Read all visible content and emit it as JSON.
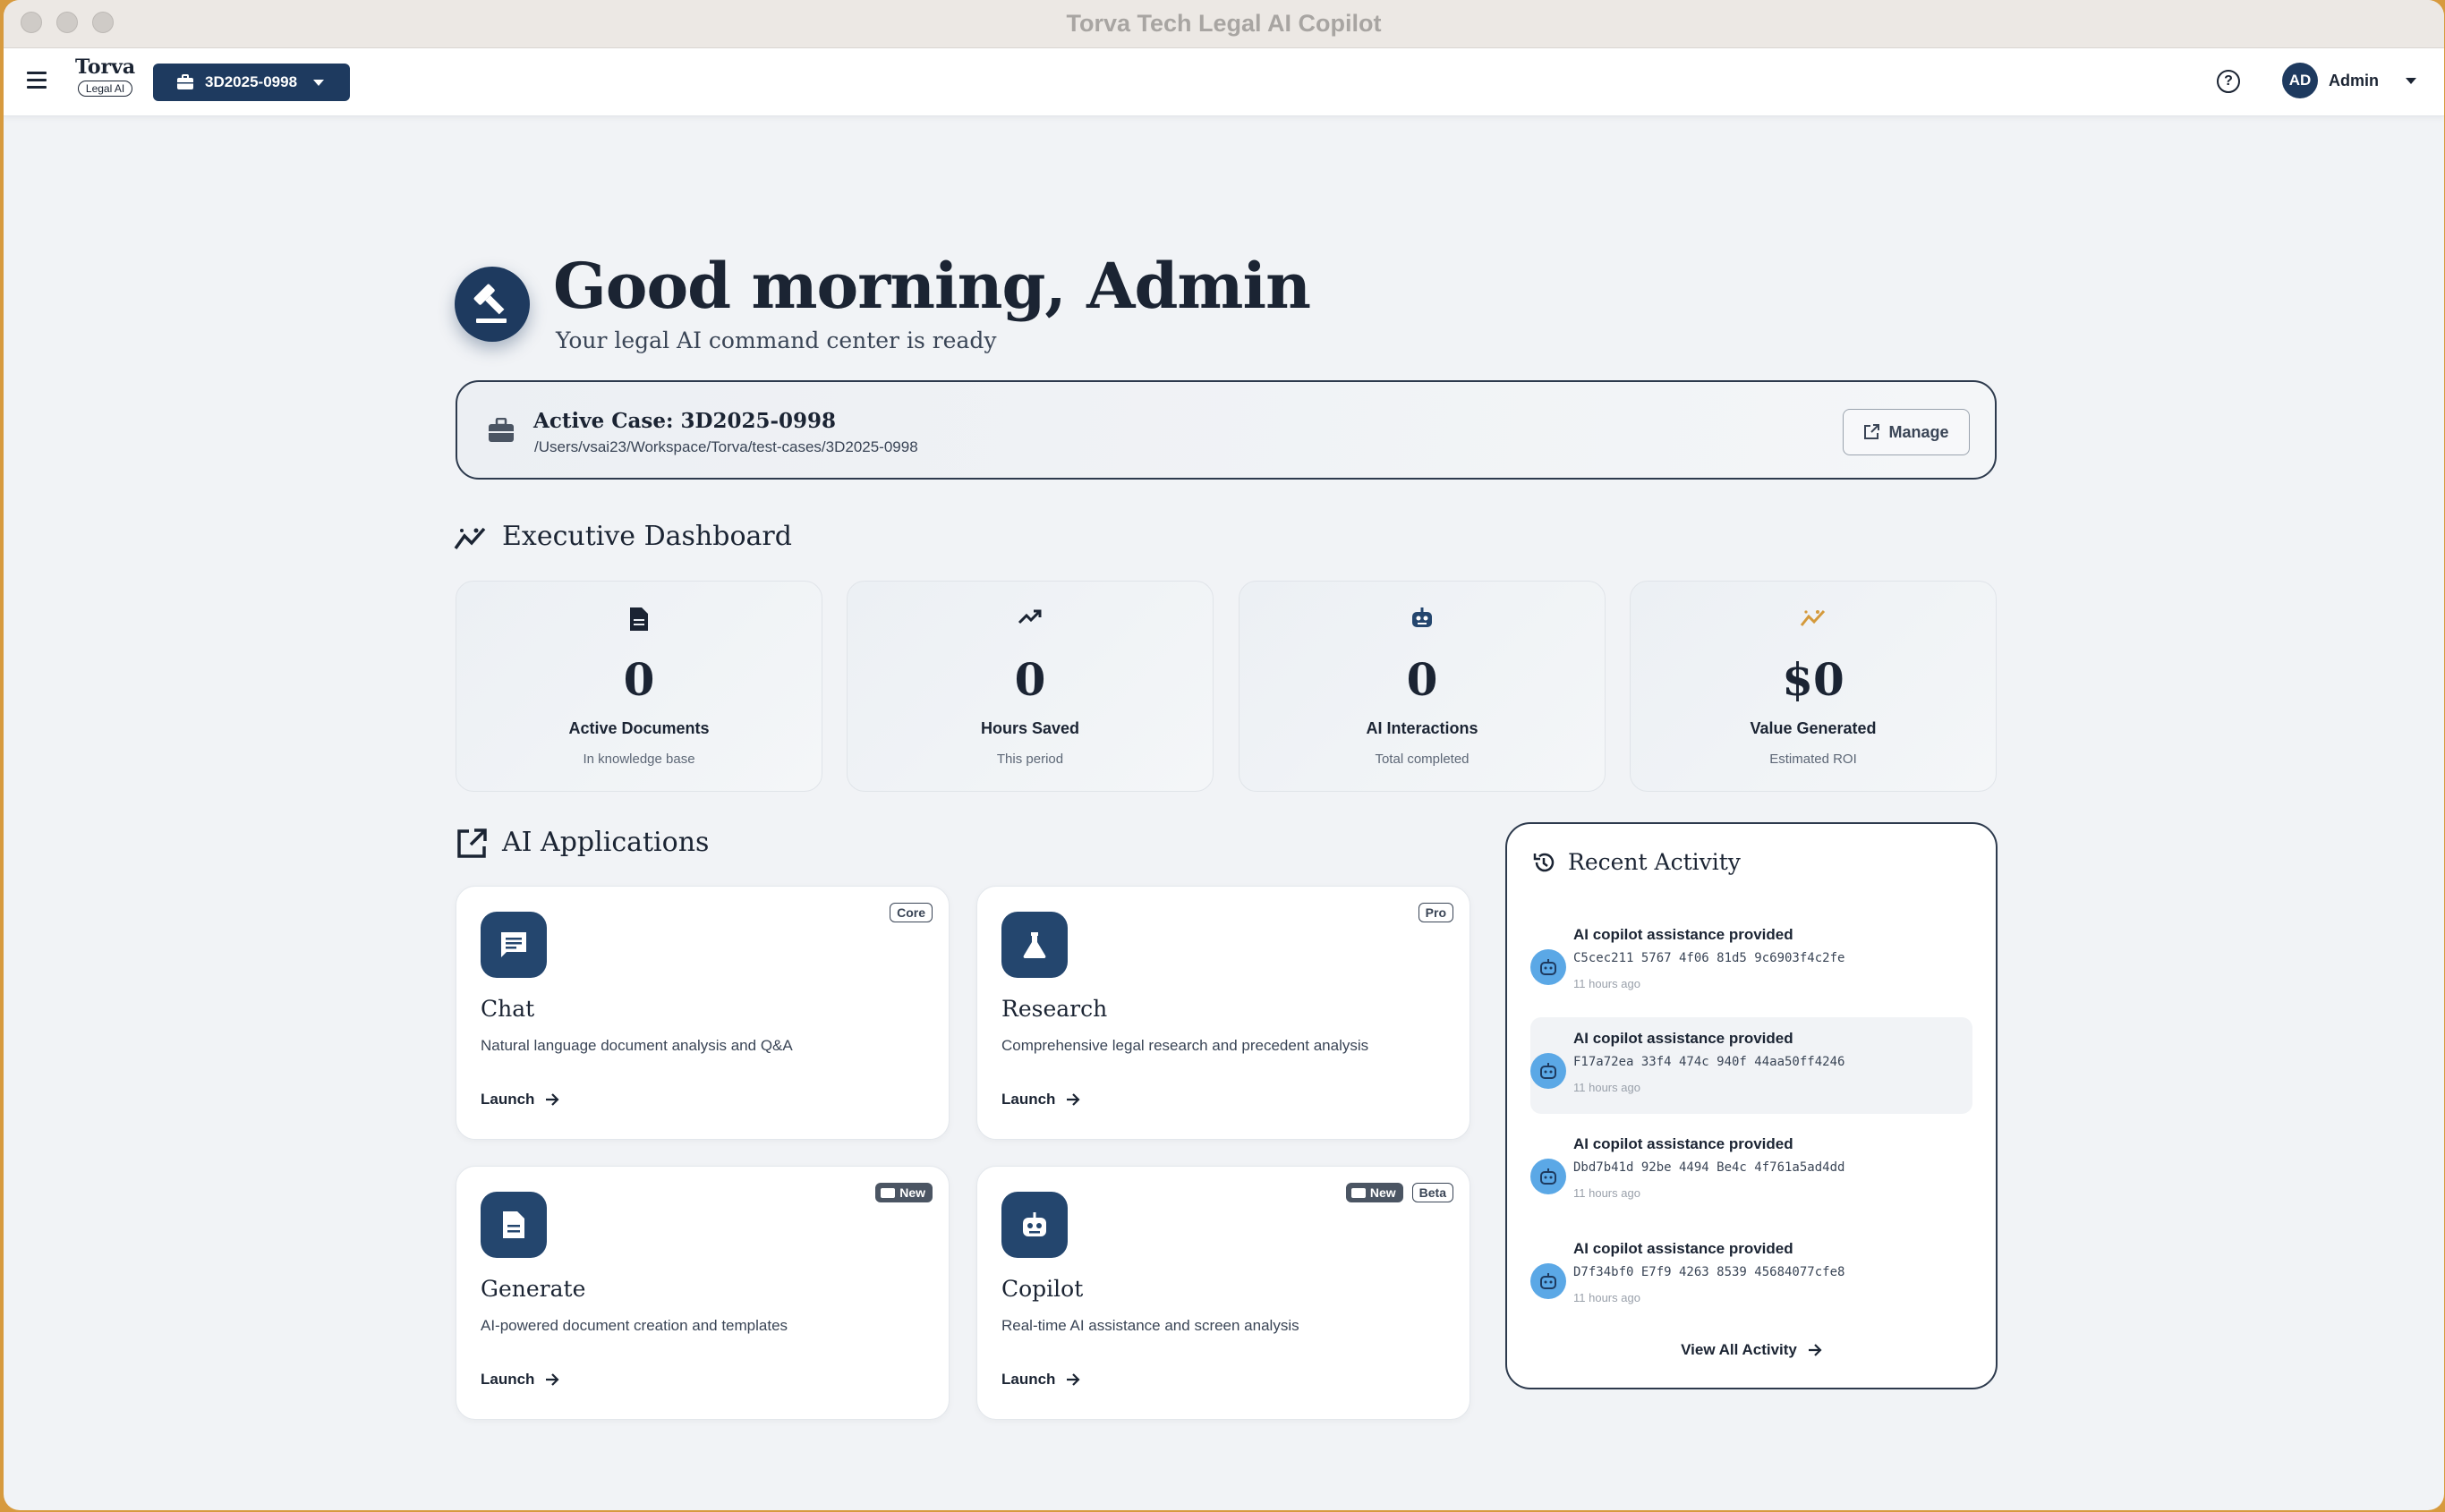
{
  "window": {
    "title": "Torva Tech Legal AI Copilot"
  },
  "header": {
    "brand_name": "Torva",
    "brand_badge": "Legal AI",
    "case_selector": "3D2025-0998",
    "user_initials": "AD",
    "user_name": "Admin"
  },
  "hero": {
    "greeting": "Good morning, Admin",
    "subtitle": "Your legal AI command center is ready"
  },
  "active_case": {
    "title": "Active Case: 3D2025-0998",
    "path": "/Users/vsai23/Workspace/Torva/test-cases/3D2025-0998",
    "manage_label": "Manage"
  },
  "dashboard": {
    "title": "Executive Dashboard",
    "stats": [
      {
        "value": "0",
        "label": "Active Documents",
        "sub": "In knowledge base",
        "icon": "document-icon",
        "color": "#1b2433"
      },
      {
        "value": "0",
        "label": "Hours Saved",
        "sub": "This period",
        "icon": "trending-up-icon",
        "color": "#1b2433"
      },
      {
        "value": "0",
        "label": "AI Interactions",
        "sub": "Total completed",
        "icon": "robot-icon",
        "color": "#24466e"
      },
      {
        "value": "$0",
        "label": "Value Generated",
        "sub": "Estimated ROI",
        "icon": "insights-icon",
        "color": "#d49a3c"
      }
    ]
  },
  "applications": {
    "title": "AI Applications",
    "launch_label": "Launch",
    "new_label": "New",
    "items": [
      {
        "name": "Chat",
        "desc": "Natural language document analysis and Q&A",
        "badge": "Core",
        "icon": "chat-icon"
      },
      {
        "name": "Research",
        "desc": "Comprehensive legal research and precedent analysis",
        "badge": "Pro",
        "icon": "flask-icon"
      },
      {
        "name": "Generate",
        "desc": "AI-powered document creation and templates",
        "icon": "document-icon"
      },
      {
        "name": "Copilot",
        "desc": "Real-time AI assistance and screen analysis",
        "badge": "Beta",
        "icon": "robot-icon"
      }
    ]
  },
  "activity": {
    "title": "Recent Activity",
    "view_all": "View All Activity",
    "items": [
      {
        "title": "AI copilot assistance provided",
        "id": "C5cec211 5767 4f06 81d5 9c6903f4c2fe",
        "time": "11 hours ago"
      },
      {
        "title": "AI copilot assistance provided",
        "id": "F17a72ea 33f4 474c 940f 44aa50ff4246",
        "time": "11 hours ago"
      },
      {
        "title": "AI copilot assistance provided",
        "id": "Dbd7b41d 92be 4494 Be4c 4f761a5ad4dd",
        "time": "11 hours ago"
      },
      {
        "title": "AI copilot assistance provided",
        "id": "D7f34bf0 E7f9 4263 8539 45684077cfe8",
        "time": "11 hours ago"
      }
    ]
  }
}
